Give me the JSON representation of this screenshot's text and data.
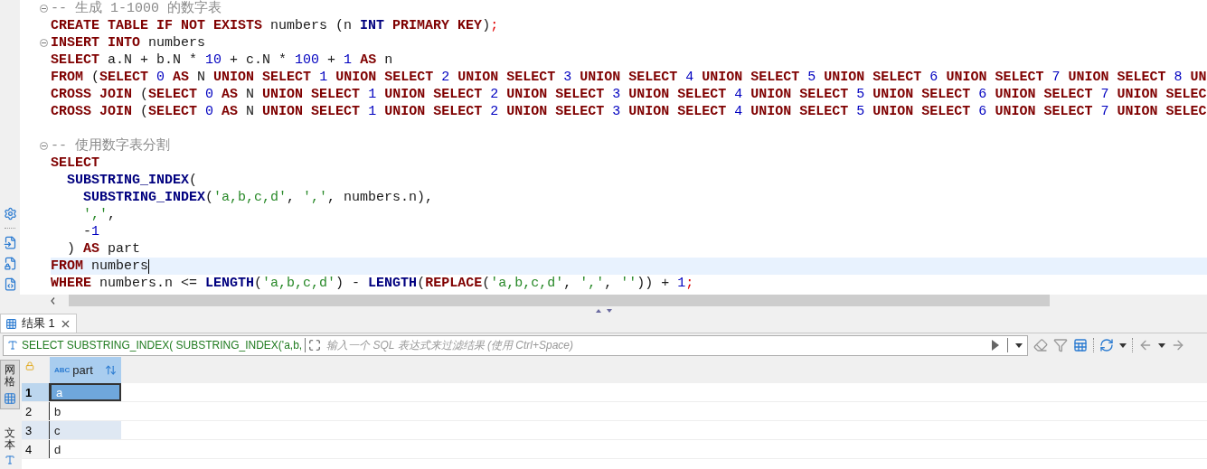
{
  "editor": {
    "blocks": [
      {
        "lines": [
          {
            "fold": true,
            "current": false,
            "tokens": [
              {
                "kind": "comment",
                "text": "-- 生成 1-1000 的数字表"
              }
            ]
          },
          {
            "fold": false,
            "current": false,
            "tokens": [
              {
                "kind": "keyword",
                "text": "CREATE TABLE IF NOT EXISTS"
              },
              {
                "kind": "plain",
                "text": " numbers (n "
              },
              {
                "kind": "function",
                "text": "INT"
              },
              {
                "kind": "keyword",
                "text": " PRIMARY KEY"
              },
              {
                "kind": "plain",
                "text": ")"
              },
              {
                "kind": "terminator",
                "text": ";"
              }
            ]
          },
          {
            "fold": true,
            "current": false,
            "tokens": [
              {
                "kind": "keyword",
                "text": "INSERT INTO"
              },
              {
                "kind": "plain",
                "text": " numbers"
              }
            ]
          },
          {
            "fold": false,
            "current": false,
            "tokens": [
              {
                "kind": "keyword",
                "text": "SELECT"
              },
              {
                "kind": "plain",
                "text": " a.N + b.N * "
              },
              {
                "kind": "number",
                "text": "10"
              },
              {
                "kind": "plain",
                "text": " + c.N * "
              },
              {
                "kind": "number",
                "text": "100"
              },
              {
                "kind": "plain",
                "text": " + "
              },
              {
                "kind": "number",
                "text": "1"
              },
              {
                "kind": "keyword",
                "text": " AS"
              },
              {
                "kind": "plain",
                "text": " n"
              }
            ]
          },
          {
            "fold": false,
            "current": false,
            "tokens": [
              {
                "kind": "keyword",
                "text": "FROM"
              },
              {
                "kind": "plain",
                "text": " ("
              },
              {
                "kind": "keyword",
                "text": "SELECT"
              },
              {
                "kind": "number",
                "text": " 0"
              },
              {
                "kind": "keyword",
                "text": " AS"
              },
              {
                "kind": "plain",
                "text": " N"
              },
              {
                "kind": "keyword",
                "text": " UNION SELECT"
              },
              {
                "kind": "number",
                "text": " 1"
              },
              {
                "kind": "keyword",
                "text": " UNION SELECT"
              },
              {
                "kind": "number",
                "text": " 2"
              },
              {
                "kind": "keyword",
                "text": " UNION SELECT"
              },
              {
                "kind": "number",
                "text": " 3"
              },
              {
                "kind": "keyword",
                "text": " UNION SELECT"
              },
              {
                "kind": "number",
                "text": " 4"
              },
              {
                "kind": "keyword",
                "text": " UNION SELECT"
              },
              {
                "kind": "number",
                "text": " 5"
              },
              {
                "kind": "keyword",
                "text": " UNION SELECT"
              },
              {
                "kind": "number",
                "text": " 6"
              },
              {
                "kind": "keyword",
                "text": " UNION SELECT"
              },
              {
                "kind": "number",
                "text": " 7"
              },
              {
                "kind": "keyword",
                "text": " UNION SELECT"
              },
              {
                "kind": "number",
                "text": " 8"
              },
              {
                "kind": "keyword",
                "text": " UN"
              }
            ]
          },
          {
            "fold": false,
            "current": false,
            "tokens": [
              {
                "kind": "keyword",
                "text": "CROSS JOIN"
              },
              {
                "kind": "plain",
                "text": " ("
              },
              {
                "kind": "keyword",
                "text": "SELECT"
              },
              {
                "kind": "number",
                "text": " 0"
              },
              {
                "kind": "keyword",
                "text": " AS"
              },
              {
                "kind": "plain",
                "text": " N"
              },
              {
                "kind": "keyword",
                "text": " UNION SELECT"
              },
              {
                "kind": "number",
                "text": " 1"
              },
              {
                "kind": "keyword",
                "text": " UNION SELECT"
              },
              {
                "kind": "number",
                "text": " 2"
              },
              {
                "kind": "keyword",
                "text": " UNION SELECT"
              },
              {
                "kind": "number",
                "text": " 3"
              },
              {
                "kind": "keyword",
                "text": " UNION SELECT"
              },
              {
                "kind": "number",
                "text": " 4"
              },
              {
                "kind": "keyword",
                "text": " UNION SELECT"
              },
              {
                "kind": "number",
                "text": " 5"
              },
              {
                "kind": "keyword",
                "text": " UNION SELECT"
              },
              {
                "kind": "number",
                "text": " 6"
              },
              {
                "kind": "keyword",
                "text": " UNION SELECT"
              },
              {
                "kind": "number",
                "text": " 7"
              },
              {
                "kind": "keyword",
                "text": " UNION SELEC"
              }
            ]
          },
          {
            "fold": false,
            "current": false,
            "tokens": [
              {
                "kind": "keyword",
                "text": "CROSS JOIN"
              },
              {
                "kind": "plain",
                "text": " ("
              },
              {
                "kind": "keyword",
                "text": "SELECT"
              },
              {
                "kind": "number",
                "text": " 0"
              },
              {
                "kind": "keyword",
                "text": " AS"
              },
              {
                "kind": "plain",
                "text": " N"
              },
              {
                "kind": "keyword",
                "text": " UNION SELECT"
              },
              {
                "kind": "number",
                "text": " 1"
              },
              {
                "kind": "keyword",
                "text": " UNION SELECT"
              },
              {
                "kind": "number",
                "text": " 2"
              },
              {
                "kind": "keyword",
                "text": " UNION SELECT"
              },
              {
                "kind": "number",
                "text": " 3"
              },
              {
                "kind": "keyword",
                "text": " UNION SELECT"
              },
              {
                "kind": "number",
                "text": " 4"
              },
              {
                "kind": "keyword",
                "text": " UNION SELECT"
              },
              {
                "kind": "number",
                "text": " 5"
              },
              {
                "kind": "keyword",
                "text": " UNION SELECT"
              },
              {
                "kind": "number",
                "text": " 6"
              },
              {
                "kind": "keyword",
                "text": " UNION SELECT"
              },
              {
                "kind": "number",
                "text": " 7"
              },
              {
                "kind": "keyword",
                "text": " UNION SELEC"
              }
            ]
          }
        ]
      },
      {
        "lines": [
          {
            "fold": true,
            "current": false,
            "tokens": [
              {
                "kind": "comment",
                "text": "-- 使用数字表分割"
              }
            ]
          },
          {
            "fold": false,
            "current": false,
            "tokens": [
              {
                "kind": "keyword",
                "text": "SELECT"
              }
            ]
          },
          {
            "fold": false,
            "current": false,
            "tokens": [
              {
                "kind": "function",
                "text": "  SUBSTRING_INDEX"
              },
              {
                "kind": "plain",
                "text": "("
              }
            ]
          },
          {
            "fold": false,
            "current": false,
            "tokens": [
              {
                "kind": "function",
                "text": "    SUBSTRING_INDEX"
              },
              {
                "kind": "plain",
                "text": "("
              },
              {
                "kind": "string",
                "text": "'a,b,c,d'"
              },
              {
                "kind": "plain",
                "text": ", "
              },
              {
                "kind": "string",
                "text": "','"
              },
              {
                "kind": "plain",
                "text": ", numbers.n),"
              }
            ]
          },
          {
            "fold": false,
            "current": false,
            "tokens": [
              {
                "kind": "string",
                "text": "    ','"
              },
              {
                "kind": "plain",
                "text": ","
              }
            ]
          },
          {
            "fold": false,
            "current": false,
            "tokens": [
              {
                "kind": "plain",
                "text": "    -"
              },
              {
                "kind": "number",
                "text": "1"
              }
            ]
          },
          {
            "fold": false,
            "current": false,
            "tokens": [
              {
                "kind": "plain",
                "text": "  )"
              },
              {
                "kind": "keyword",
                "text": " AS"
              },
              {
                "kind": "plain",
                "text": " part"
              }
            ]
          },
          {
            "fold": false,
            "current": true,
            "tokens": [
              {
                "kind": "keyword",
                "text": "FROM"
              },
              {
                "kind": "plain",
                "text": " numbers"
              }
            ]
          },
          {
            "fold": false,
            "current": false,
            "tokens": [
              {
                "kind": "keyword",
                "text": "WHERE"
              },
              {
                "kind": "plain",
                "text": " numbers.n <= "
              },
              {
                "kind": "function",
                "text": "LENGTH"
              },
              {
                "kind": "plain",
                "text": "("
              },
              {
                "kind": "string",
                "text": "'a,b,c,d'"
              },
              {
                "kind": "plain",
                "text": ") - "
              },
              {
                "kind": "function",
                "text": "LENGTH"
              },
              {
                "kind": "plain",
                "text": "("
              },
              {
                "kind": "keyword",
                "text": "REPLACE"
              },
              {
                "kind": "plain",
                "text": "("
              },
              {
                "kind": "string",
                "text": "'a,b,c,d'"
              },
              {
                "kind": "plain",
                "text": ", "
              },
              {
                "kind": "string",
                "text": "','"
              },
              {
                "kind": "plain",
                "text": ", "
              },
              {
                "kind": "string",
                "text": "''"
              },
              {
                "kind": "plain",
                "text": ")) + "
              },
              {
                "kind": "number",
                "text": "1"
              },
              {
                "kind": "terminator",
                "text": ";"
              }
            ]
          }
        ]
      }
    ]
  },
  "results": {
    "tabs": [
      {
        "label": "结果 1",
        "selected": true
      }
    ],
    "filter": {
      "query": "SELECT SUBSTRING_INDEX( SUBSTRING_INDEX('a,b,",
      "placeholder": "输入一个 SQL 表达式来过滤结果 (使用 Ctrl+Space)"
    },
    "view_tabs": [
      {
        "label": "网格",
        "selected": true
      },
      {
        "label": "文本",
        "selected": false
      }
    ],
    "columns": [
      {
        "type_badge": "ABC",
        "name": "part"
      }
    ],
    "rows": [
      {
        "number": "1",
        "cells": [
          "a"
        ],
        "selected": true,
        "highlighted": false
      },
      {
        "number": "2",
        "cells": [
          "b"
        ],
        "selected": false,
        "highlighted": false
      },
      {
        "number": "3",
        "cells": [
          "c"
        ],
        "selected": false,
        "highlighted": true
      },
      {
        "number": "4",
        "cells": [
          "d"
        ],
        "selected": false,
        "highlighted": false
      }
    ]
  }
}
